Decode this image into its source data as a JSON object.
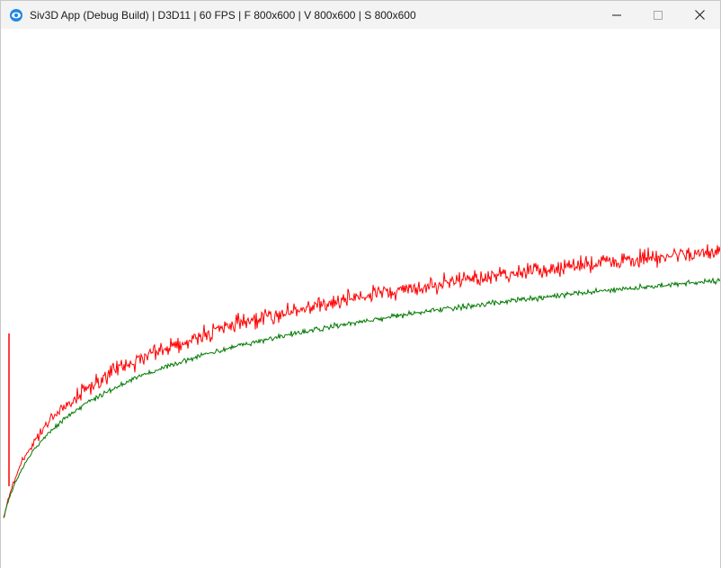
{
  "window": {
    "title": "Siv3D App (Debug Build) | D3D11 | 60 FPS | F 800x600 | V 800x600 | S 800x600",
    "icon": "siv3d-app-icon",
    "controls": [
      "minimize-icon",
      "maximize-icon",
      "close-icon"
    ]
  },
  "scene": {
    "background": "#ffffff",
    "series": [
      {
        "color": "#ff0000",
        "noise": 8,
        "start": 575,
        "asymptote": 278
      },
      {
        "color": "#007800",
        "noise": 2.5,
        "start": 575,
        "asymptote": 311
      }
    ],
    "spike": {
      "color": "#ff0000",
      "x": 9,
      "top": 370,
      "bottom": 540
    }
  }
}
